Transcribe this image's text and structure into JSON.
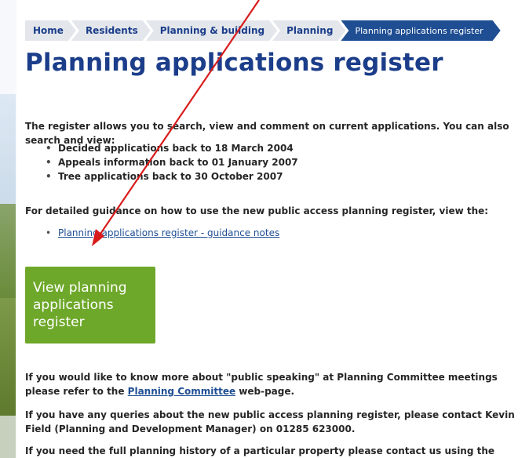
{
  "breadcrumb": {
    "items": [
      "Home",
      "Residents",
      "Planning & building",
      "Planning"
    ],
    "current": "Planning applications register"
  },
  "page": {
    "title": "Planning applications register"
  },
  "intro": {
    "text": "The register allows you to search, view and comment on current applications. You can also search and view:"
  },
  "bullets": [
    "Decided applications back to 18 March 2004",
    "Appeals information back to 01 January 2007",
    "Tree applications back to 30 October 2007"
  ],
  "guidance": {
    "text": "For detailed guidance on how to use the new public access planning register, view the:",
    "link_label": "Planning applications register - guidance notes"
  },
  "cta": {
    "label": "View planning applications register"
  },
  "paragraphs": {
    "public_speaking_before": " If you would like to know more about \"public speaking\" at Planning Committee meetings please refer to the ",
    "public_speaking_link": "Planning Committee",
    "public_speaking_after": " web-page.",
    "queries": "If you have any queries about the new public access planning register, please contact Kevin Field (Planning and Development Manager) on 01285 623000.",
    "history": "If you need the full planning history of a particular property please contact us using the details below."
  },
  "colors": {
    "brand_blue": "#1b3d8a",
    "breadcrumb_current": "#1f4e93",
    "cta_green": "#6ea82a",
    "annotation_red": "#d91b1b"
  }
}
